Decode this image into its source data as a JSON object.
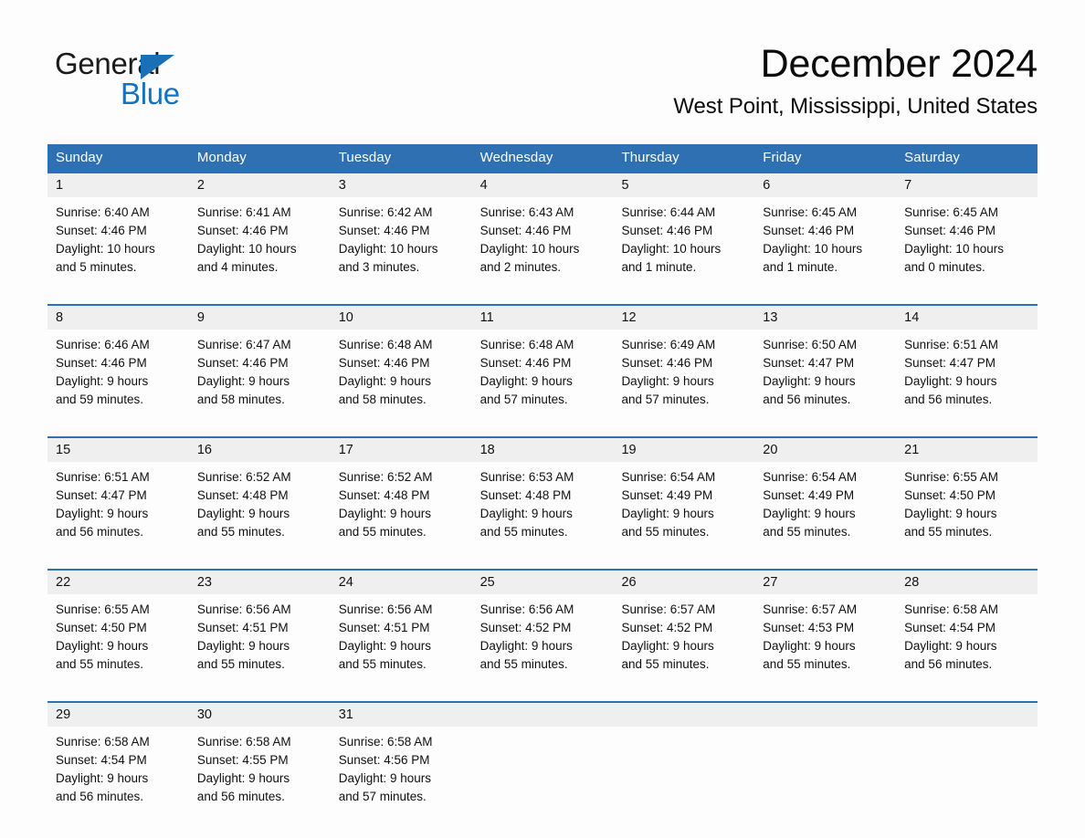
{
  "brand": {
    "name_part1": "General",
    "name_part2": "Blue",
    "triangle_color": "#1a6fb5",
    "blue_color": "#1272c4"
  },
  "header": {
    "title": "December 2024",
    "subtitle": "West Point, Mississippi, United States"
  },
  "theme": {
    "header_blue": "#2e70b2",
    "daynum_gray": "#efefef",
    "page_background": "#fdfdfd"
  },
  "weekdays": [
    "Sunday",
    "Monday",
    "Tuesday",
    "Wednesday",
    "Thursday",
    "Friday",
    "Saturday"
  ],
  "weeks": [
    [
      {
        "day": "1",
        "sunrise": "Sunrise: 6:40 AM",
        "sunset": "Sunset: 4:46 PM",
        "daylight1": "Daylight: 10 hours",
        "daylight2": "and 5 minutes."
      },
      {
        "day": "2",
        "sunrise": "Sunrise: 6:41 AM",
        "sunset": "Sunset: 4:46 PM",
        "daylight1": "Daylight: 10 hours",
        "daylight2": "and 4 minutes."
      },
      {
        "day": "3",
        "sunrise": "Sunrise: 6:42 AM",
        "sunset": "Sunset: 4:46 PM",
        "daylight1": "Daylight: 10 hours",
        "daylight2": "and 3 minutes."
      },
      {
        "day": "4",
        "sunrise": "Sunrise: 6:43 AM",
        "sunset": "Sunset: 4:46 PM",
        "daylight1": "Daylight: 10 hours",
        "daylight2": "and 2 minutes."
      },
      {
        "day": "5",
        "sunrise": "Sunrise: 6:44 AM",
        "sunset": "Sunset: 4:46 PM",
        "daylight1": "Daylight: 10 hours",
        "daylight2": "and 1 minute."
      },
      {
        "day": "6",
        "sunrise": "Sunrise: 6:45 AM",
        "sunset": "Sunset: 4:46 PM",
        "daylight1": "Daylight: 10 hours",
        "daylight2": "and 1 minute."
      },
      {
        "day": "7",
        "sunrise": "Sunrise: 6:45 AM",
        "sunset": "Sunset: 4:46 PM",
        "daylight1": "Daylight: 10 hours",
        "daylight2": "and 0 minutes."
      }
    ],
    [
      {
        "day": "8",
        "sunrise": "Sunrise: 6:46 AM",
        "sunset": "Sunset: 4:46 PM",
        "daylight1": "Daylight: 9 hours",
        "daylight2": "and 59 minutes."
      },
      {
        "day": "9",
        "sunrise": "Sunrise: 6:47 AM",
        "sunset": "Sunset: 4:46 PM",
        "daylight1": "Daylight: 9 hours",
        "daylight2": "and 58 minutes."
      },
      {
        "day": "10",
        "sunrise": "Sunrise: 6:48 AM",
        "sunset": "Sunset: 4:46 PM",
        "daylight1": "Daylight: 9 hours",
        "daylight2": "and 58 minutes."
      },
      {
        "day": "11",
        "sunrise": "Sunrise: 6:48 AM",
        "sunset": "Sunset: 4:46 PM",
        "daylight1": "Daylight: 9 hours",
        "daylight2": "and 57 minutes."
      },
      {
        "day": "12",
        "sunrise": "Sunrise: 6:49 AM",
        "sunset": "Sunset: 4:46 PM",
        "daylight1": "Daylight: 9 hours",
        "daylight2": "and 57 minutes."
      },
      {
        "day": "13",
        "sunrise": "Sunrise: 6:50 AM",
        "sunset": "Sunset: 4:47 PM",
        "daylight1": "Daylight: 9 hours",
        "daylight2": "and 56 minutes."
      },
      {
        "day": "14",
        "sunrise": "Sunrise: 6:51 AM",
        "sunset": "Sunset: 4:47 PM",
        "daylight1": "Daylight: 9 hours",
        "daylight2": "and 56 minutes."
      }
    ],
    [
      {
        "day": "15",
        "sunrise": "Sunrise: 6:51 AM",
        "sunset": "Sunset: 4:47 PM",
        "daylight1": "Daylight: 9 hours",
        "daylight2": "and 56 minutes."
      },
      {
        "day": "16",
        "sunrise": "Sunrise: 6:52 AM",
        "sunset": "Sunset: 4:48 PM",
        "daylight1": "Daylight: 9 hours",
        "daylight2": "and 55 minutes."
      },
      {
        "day": "17",
        "sunrise": "Sunrise: 6:52 AM",
        "sunset": "Sunset: 4:48 PM",
        "daylight1": "Daylight: 9 hours",
        "daylight2": "and 55 minutes."
      },
      {
        "day": "18",
        "sunrise": "Sunrise: 6:53 AM",
        "sunset": "Sunset: 4:48 PM",
        "daylight1": "Daylight: 9 hours",
        "daylight2": "and 55 minutes."
      },
      {
        "day": "19",
        "sunrise": "Sunrise: 6:54 AM",
        "sunset": "Sunset: 4:49 PM",
        "daylight1": "Daylight: 9 hours",
        "daylight2": "and 55 minutes."
      },
      {
        "day": "20",
        "sunrise": "Sunrise: 6:54 AM",
        "sunset": "Sunset: 4:49 PM",
        "daylight1": "Daylight: 9 hours",
        "daylight2": "and 55 minutes."
      },
      {
        "day": "21",
        "sunrise": "Sunrise: 6:55 AM",
        "sunset": "Sunset: 4:50 PM",
        "daylight1": "Daylight: 9 hours",
        "daylight2": "and 55 minutes."
      }
    ],
    [
      {
        "day": "22",
        "sunrise": "Sunrise: 6:55 AM",
        "sunset": "Sunset: 4:50 PM",
        "daylight1": "Daylight: 9 hours",
        "daylight2": "and 55 minutes."
      },
      {
        "day": "23",
        "sunrise": "Sunrise: 6:56 AM",
        "sunset": "Sunset: 4:51 PM",
        "daylight1": "Daylight: 9 hours",
        "daylight2": "and 55 minutes."
      },
      {
        "day": "24",
        "sunrise": "Sunrise: 6:56 AM",
        "sunset": "Sunset: 4:51 PM",
        "daylight1": "Daylight: 9 hours",
        "daylight2": "and 55 minutes."
      },
      {
        "day": "25",
        "sunrise": "Sunrise: 6:56 AM",
        "sunset": "Sunset: 4:52 PM",
        "daylight1": "Daylight: 9 hours",
        "daylight2": "and 55 minutes."
      },
      {
        "day": "26",
        "sunrise": "Sunrise: 6:57 AM",
        "sunset": "Sunset: 4:52 PM",
        "daylight1": "Daylight: 9 hours",
        "daylight2": "and 55 minutes."
      },
      {
        "day": "27",
        "sunrise": "Sunrise: 6:57 AM",
        "sunset": "Sunset: 4:53 PM",
        "daylight1": "Daylight: 9 hours",
        "daylight2": "and 55 minutes."
      },
      {
        "day": "28",
        "sunrise": "Sunrise: 6:58 AM",
        "sunset": "Sunset: 4:54 PM",
        "daylight1": "Daylight: 9 hours",
        "daylight2": "and 56 minutes."
      }
    ],
    [
      {
        "day": "29",
        "sunrise": "Sunrise: 6:58 AM",
        "sunset": "Sunset: 4:54 PM",
        "daylight1": "Daylight: 9 hours",
        "daylight2": "and 56 minutes."
      },
      {
        "day": "30",
        "sunrise": "Sunrise: 6:58 AM",
        "sunset": "Sunset: 4:55 PM",
        "daylight1": "Daylight: 9 hours",
        "daylight2": "and 56 minutes."
      },
      {
        "day": "31",
        "sunrise": "Sunrise: 6:58 AM",
        "sunset": "Sunset: 4:56 PM",
        "daylight1": "Daylight: 9 hours",
        "daylight2": "and 57 minutes."
      },
      {
        "day": "",
        "sunrise": "",
        "sunset": "",
        "daylight1": "",
        "daylight2": ""
      },
      {
        "day": "",
        "sunrise": "",
        "sunset": "",
        "daylight1": "",
        "daylight2": ""
      },
      {
        "day": "",
        "sunrise": "",
        "sunset": "",
        "daylight1": "",
        "daylight2": ""
      },
      {
        "day": "",
        "sunrise": "",
        "sunset": "",
        "daylight1": "",
        "daylight2": ""
      }
    ]
  ]
}
